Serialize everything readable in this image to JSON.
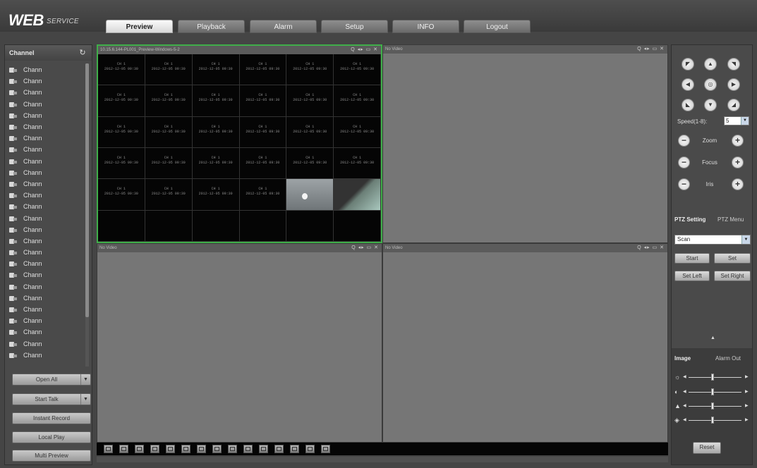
{
  "header": {
    "logo": "WEB",
    "logo_sub": "SERVICE",
    "tabs": [
      "Preview",
      "Playback",
      "Alarm",
      "Setup",
      "INFO",
      "Logout"
    ],
    "active_tab": "Preview"
  },
  "channels": {
    "title": "Channel",
    "items": [
      "Chann",
      "Chann",
      "Chann",
      "Chann",
      "Chann",
      "Chann",
      "Chann",
      "Chann",
      "Chann",
      "Chann",
      "Chann",
      "Chann",
      "Chann",
      "Chann",
      "Chann",
      "Chann",
      "Chann",
      "Chann",
      "Chann",
      "Chann",
      "Chann",
      "Chann",
      "Chann",
      "Chann",
      "Chann",
      "Chann"
    ]
  },
  "left_buttons": {
    "open_all": "Open All",
    "start_talk": "Start Talk",
    "instant_record": "Instant Record",
    "local_play": "Local Play",
    "multi_preview": "Multi Preview"
  },
  "panes": [
    {
      "title": "10.15.6.144-PL001_Preview-Windows-5-2",
      "icons": "Q ◂▸ ▭ ✕"
    },
    {
      "title": "No Video",
      "icons": "Q ◂▸ ▭ ✕"
    },
    {
      "title": "No Video",
      "icons": "Q ◂▸ ▭ ✕"
    },
    {
      "title": "No Video",
      "icons": "Q ◂▸ ▭ ✕"
    }
  ],
  "mosaic_cells": [
    {
      "l1": "CH 1",
      "l2": "2012-12-05 09:30"
    }
  ],
  "ptz": {
    "speed_label": "Speed(1-8):",
    "speed_value": "5",
    "zoom_label": "Zoom",
    "focus_label": "Focus",
    "iris_label": "Iris",
    "tab_setting": "PTZ Setting",
    "tab_menu": "PTZ Menu",
    "mode": "Scan",
    "start": "Start",
    "set": "Set",
    "set_left": "Set Left",
    "set_right": "Set Right"
  },
  "image": {
    "tab_image": "Image",
    "tab_alarm_out": "Alarm Out",
    "brightness": 0.45,
    "contrast": 0.45,
    "saturation": 0.45,
    "hue": 0.45,
    "reset": "Reset"
  },
  "colors": {
    "active_border": "#3fae49",
    "panel_bg": "#4a4a4a",
    "video_bg": "#767676"
  }
}
